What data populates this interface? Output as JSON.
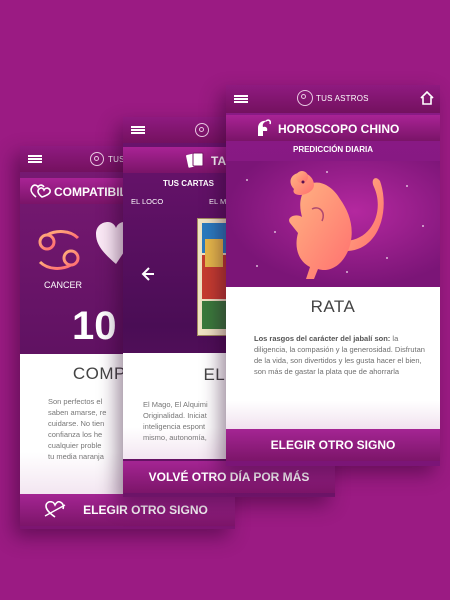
{
  "phones": {
    "left": {
      "brand": "TUS ASTROS",
      "title": "COMPATIBIL",
      "sign_name": "CANCER",
      "score": "10",
      "heading": "COMPAT",
      "description": "Son perfectos el\nsaben amarse, re\ncuidarse. No tien\nconfianza los he\ncualquier proble\ntu  media naranja",
      "footer_button": "ELEGIR OTRO SIGNO",
      "icons": [
        "hamburger-icon",
        "linked-hearts-icon",
        "cancer-symbol-icon",
        "heart-icon",
        "heart-arrow-icon"
      ]
    },
    "middle": {
      "title": "TA",
      "subtitle": "TUS CARTAS",
      "card_left": "EL LOCO",
      "card_right": "EL M",
      "heading": "EL M",
      "description": "El Mago, El Alquimi\nOriginalidad. Iniciat\ninteligencia espont\nmismo, autonomía,",
      "footer_button": "VOLVÉ OTRO DÍA POR MÁS",
      "icons": [
        "hamburger-icon",
        "tarot-cards-icon",
        "left-arrow-icon"
      ]
    },
    "right": {
      "brand": "TUS ASTROS",
      "title": "HOROSCOPO CHINO",
      "subtitle": "PREDICCIÓN DIARIA",
      "animal": "RATA",
      "description_bold": "Los rasgos del carácter del jabalí son:",
      "description": " la diligencia, la compasión y la generosidad. Disfrutan de la vida, son divertidos y les gusta hacer el bien, son más de gastar la plata que de ahorrarla",
      "footer_button": "ELEGIR OTRO SIGNO",
      "icons": [
        "hamburger-icon",
        "home-icon",
        "goat-icon",
        "rat-icon"
      ]
    }
  },
  "colors": {
    "background": "#9b1b83",
    "accent_orange": "#ff8f6b",
    "panel_text": "#777777"
  }
}
